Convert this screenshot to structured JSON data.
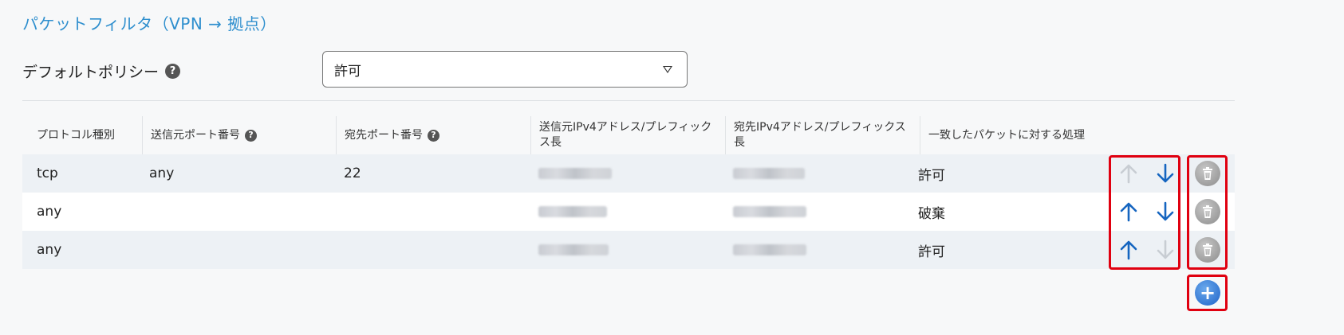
{
  "section": {
    "title": "パケットフィルタ（VPN → 拠点）"
  },
  "policy": {
    "label": "デフォルトポリシー",
    "value": "許可",
    "help_glyph": "?"
  },
  "table": {
    "columns": [
      {
        "label": "プロトコル種別"
      },
      {
        "label": "送信元ポート番号",
        "help": "?"
      },
      {
        "label": "宛先ポート番号",
        "help": "?"
      },
      {
        "label": "送信元IPv4アドレス/プレフィックス長"
      },
      {
        "label": "宛先IPv4アドレス/プレフィックス長"
      },
      {
        "label": "一致したパケットに対する処理"
      }
    ],
    "rows": [
      {
        "protocol": "tcp",
        "src_port": "any",
        "dst_port": "22",
        "action": "許可",
        "up_enabled": false,
        "down_enabled": true
      },
      {
        "protocol": "any",
        "src_port": "",
        "dst_port": "",
        "action": "破棄",
        "up_enabled": true,
        "down_enabled": true
      },
      {
        "protocol": "any",
        "src_port": "",
        "dst_port": "",
        "action": "許可",
        "up_enabled": true,
        "down_enabled": false
      }
    ]
  },
  "add_button": {
    "glyph": "+"
  },
  "colors": {
    "accent": "#2f8fce",
    "arrow_active": "#1565c0",
    "arrow_disabled": "#c8cdd3",
    "highlight": "#e00010"
  }
}
